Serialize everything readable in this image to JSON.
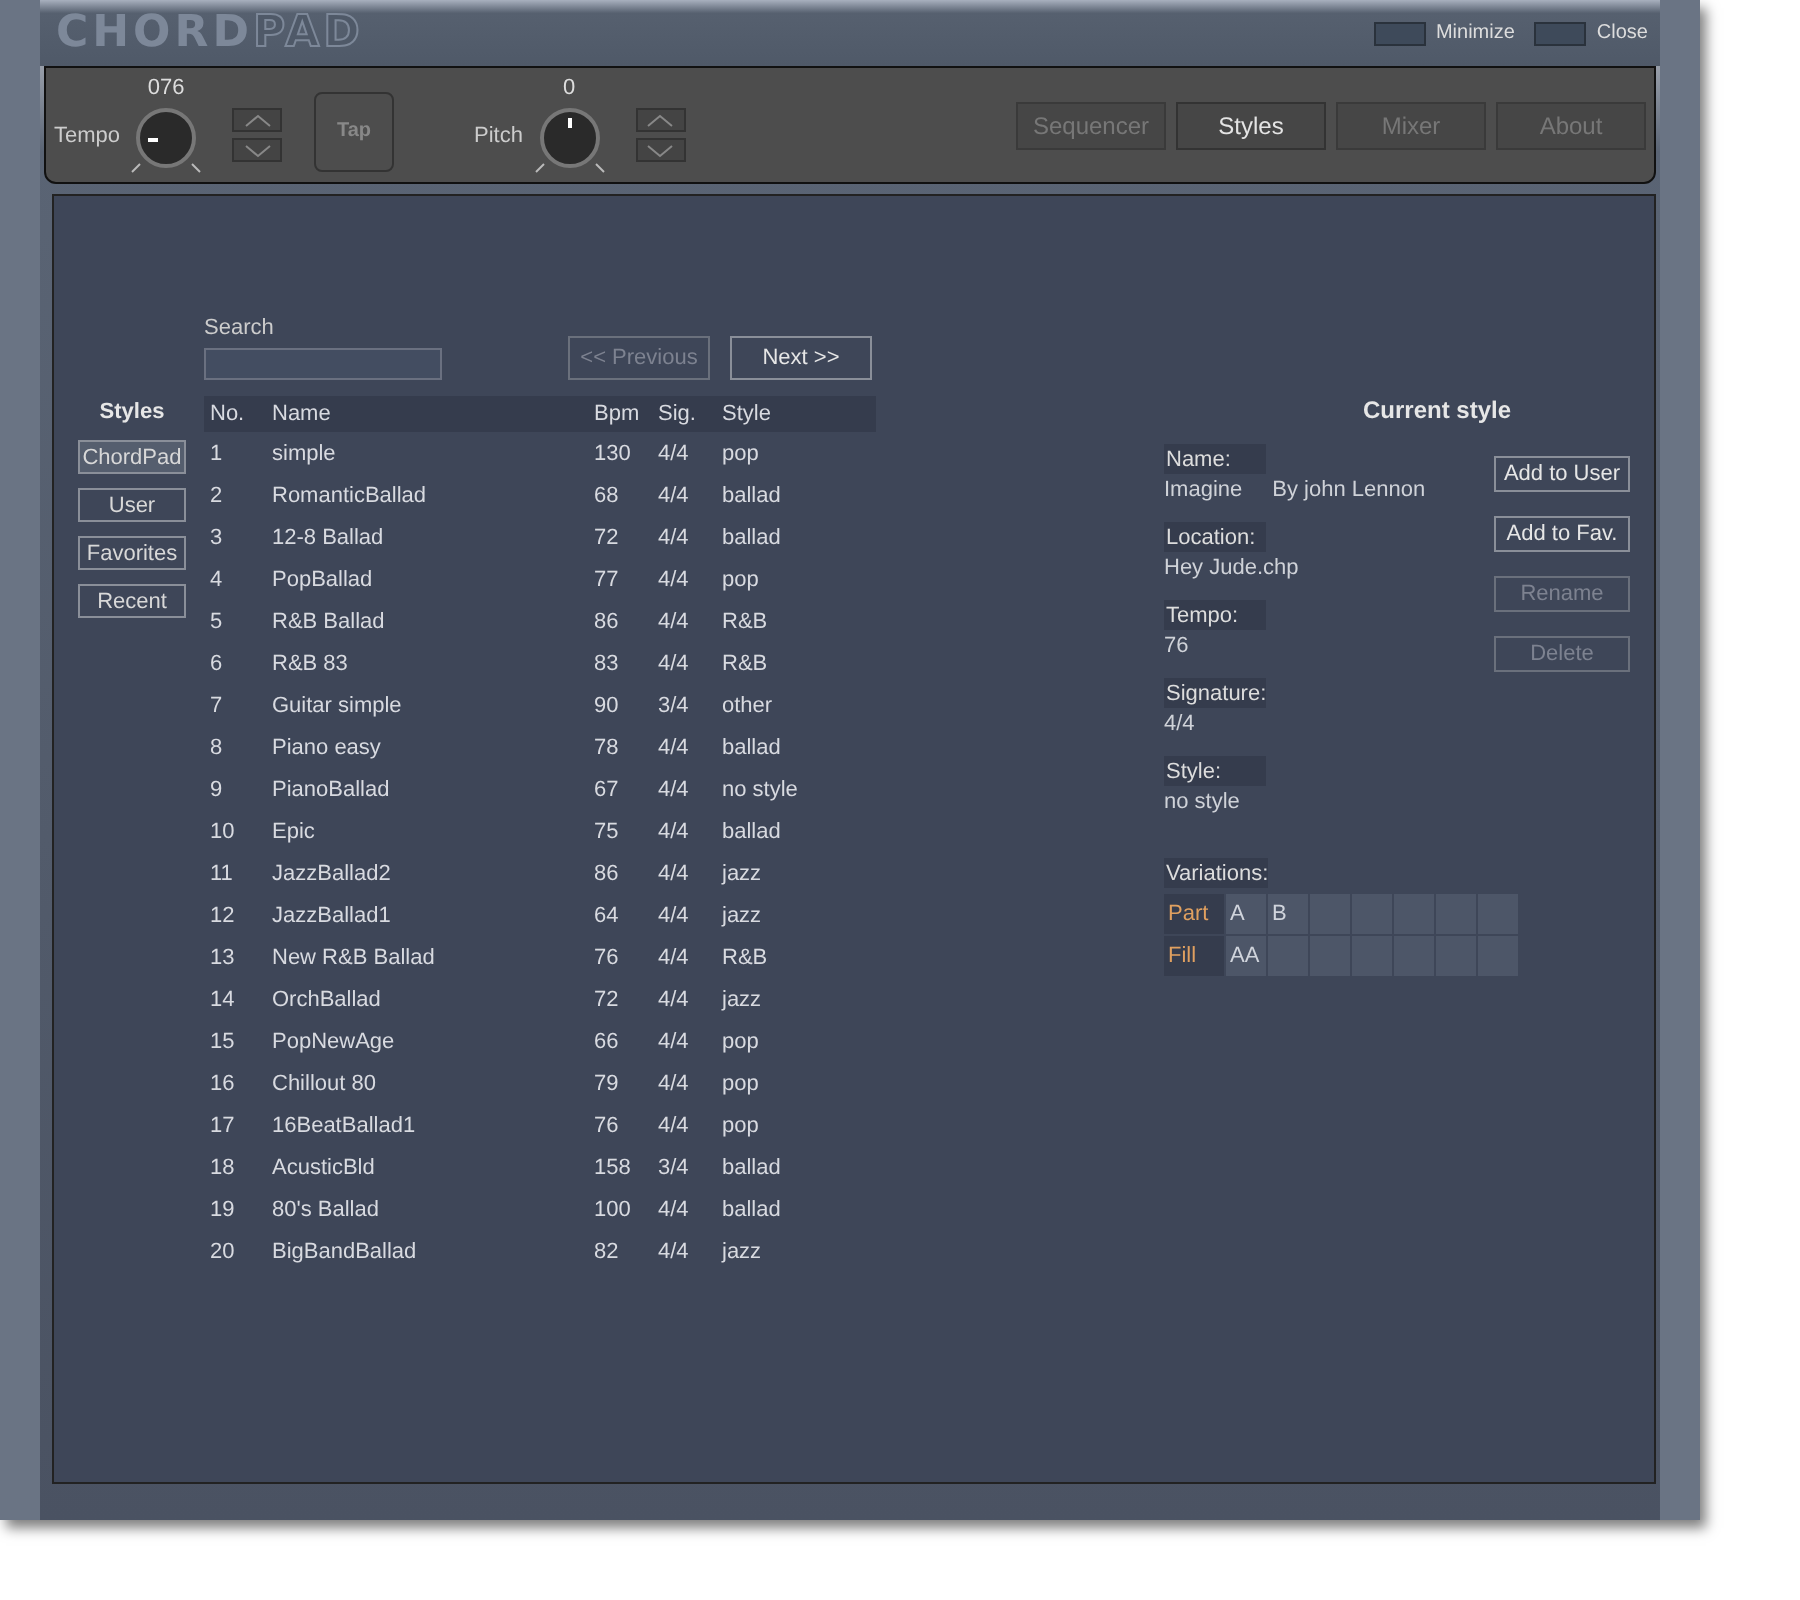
{
  "window": {
    "logo_solid": "CHORD",
    "logo_outline": "PAD",
    "buttons": [
      {
        "label": "Minimize"
      },
      {
        "label": "Close"
      }
    ]
  },
  "toolbar": {
    "tempo": {
      "label": "Tempo",
      "reading": "076"
    },
    "tap": "Tap",
    "pitch": {
      "label": "Pitch",
      "reading": "0"
    },
    "tabs": [
      {
        "label": "Sequencer",
        "selected": false
      },
      {
        "label": "Styles",
        "selected": true
      },
      {
        "label": "Mixer",
        "selected": false
      },
      {
        "label": "About",
        "selected": false
      }
    ]
  },
  "search": {
    "label": "Search"
  },
  "pager": [
    {
      "label": "<< Previous",
      "disabled": true
    },
    {
      "label": "Next >>",
      "disabled": false
    }
  ],
  "categories": {
    "title": "Styles",
    "items": [
      {
        "label": "ChordPad",
        "selected": true
      },
      {
        "label": "User",
        "selected": false
      },
      {
        "label": "Favorites",
        "selected": false
      },
      {
        "label": "Recent",
        "selected": false
      }
    ]
  },
  "table": {
    "columns": [
      "No.",
      "Name",
      "Bpm",
      "Sig.",
      "Style"
    ],
    "rows": [
      [
        "1",
        "simple",
        "130",
        "4/4",
        "pop"
      ],
      [
        "2",
        "RomanticBallad",
        "68",
        "4/4",
        "ballad"
      ],
      [
        "3",
        "12-8 Ballad",
        "72",
        "4/4",
        "ballad"
      ],
      [
        "4",
        "PopBallad",
        "77",
        "4/4",
        "pop"
      ],
      [
        "5",
        "R&B Ballad",
        "86",
        "4/4",
        "R&B"
      ],
      [
        "6",
        "R&B 83",
        "83",
        "4/4",
        "R&B"
      ],
      [
        "7",
        "Guitar simple",
        "90",
        "3/4",
        "other"
      ],
      [
        "8",
        "Piano easy",
        "78",
        "4/4",
        "ballad"
      ],
      [
        "9",
        "PianoBallad",
        "67",
        "4/4",
        "no style"
      ],
      [
        "10",
        "Epic",
        "75",
        "4/4",
        "ballad"
      ],
      [
        "11",
        "JazzBallad2",
        "86",
        "4/4",
        "jazz"
      ],
      [
        "12",
        "JazzBallad1",
        "64",
        "4/4",
        "jazz"
      ],
      [
        "13",
        "New R&B Ballad",
        "76",
        "4/4",
        "R&B"
      ],
      [
        "14",
        "OrchBallad",
        "72",
        "4/4",
        "jazz"
      ],
      [
        "15",
        "PopNewAge",
        "66",
        "4/4",
        "pop"
      ],
      [
        "16",
        "Chillout 80",
        "79",
        "4/4",
        "pop"
      ],
      [
        "17",
        "16BeatBallad1",
        "76",
        "4/4",
        "pop"
      ],
      [
        "18",
        "AcusticBld",
        "158",
        "3/4",
        "ballad"
      ],
      [
        "19",
        "80's Ballad",
        "100",
        "4/4",
        "ballad"
      ],
      [
        "20",
        "BigBandBallad",
        "82",
        "4/4",
        "jazz"
      ]
    ]
  },
  "current_style": {
    "title": "Current style",
    "fields": [
      {
        "label": "Name:",
        "values": [
          "Imagine",
          "By john Lennon"
        ]
      },
      {
        "label": "Location:",
        "values": [
          "Hey Jude.chp"
        ]
      },
      {
        "label": "Tempo:",
        "values": [
          "76"
        ]
      },
      {
        "label": "Signature:",
        "values": [
          "4/4"
        ]
      },
      {
        "label": "Style:",
        "values": [
          "no style"
        ]
      }
    ],
    "actions": [
      {
        "label": "Add to User",
        "disabled": false
      },
      {
        "label": "Add to Fav.",
        "disabled": false
      },
      {
        "label": "Rename",
        "disabled": true
      },
      {
        "label": "Delete",
        "disabled": true
      }
    ],
    "variations": {
      "label": "Variations:",
      "rows": [
        {
          "label": "Part",
          "cells": [
            "A",
            "B"
          ]
        },
        {
          "label": "Fill",
          "cells": [
            "AA"
          ]
        }
      ]
    }
  }
}
